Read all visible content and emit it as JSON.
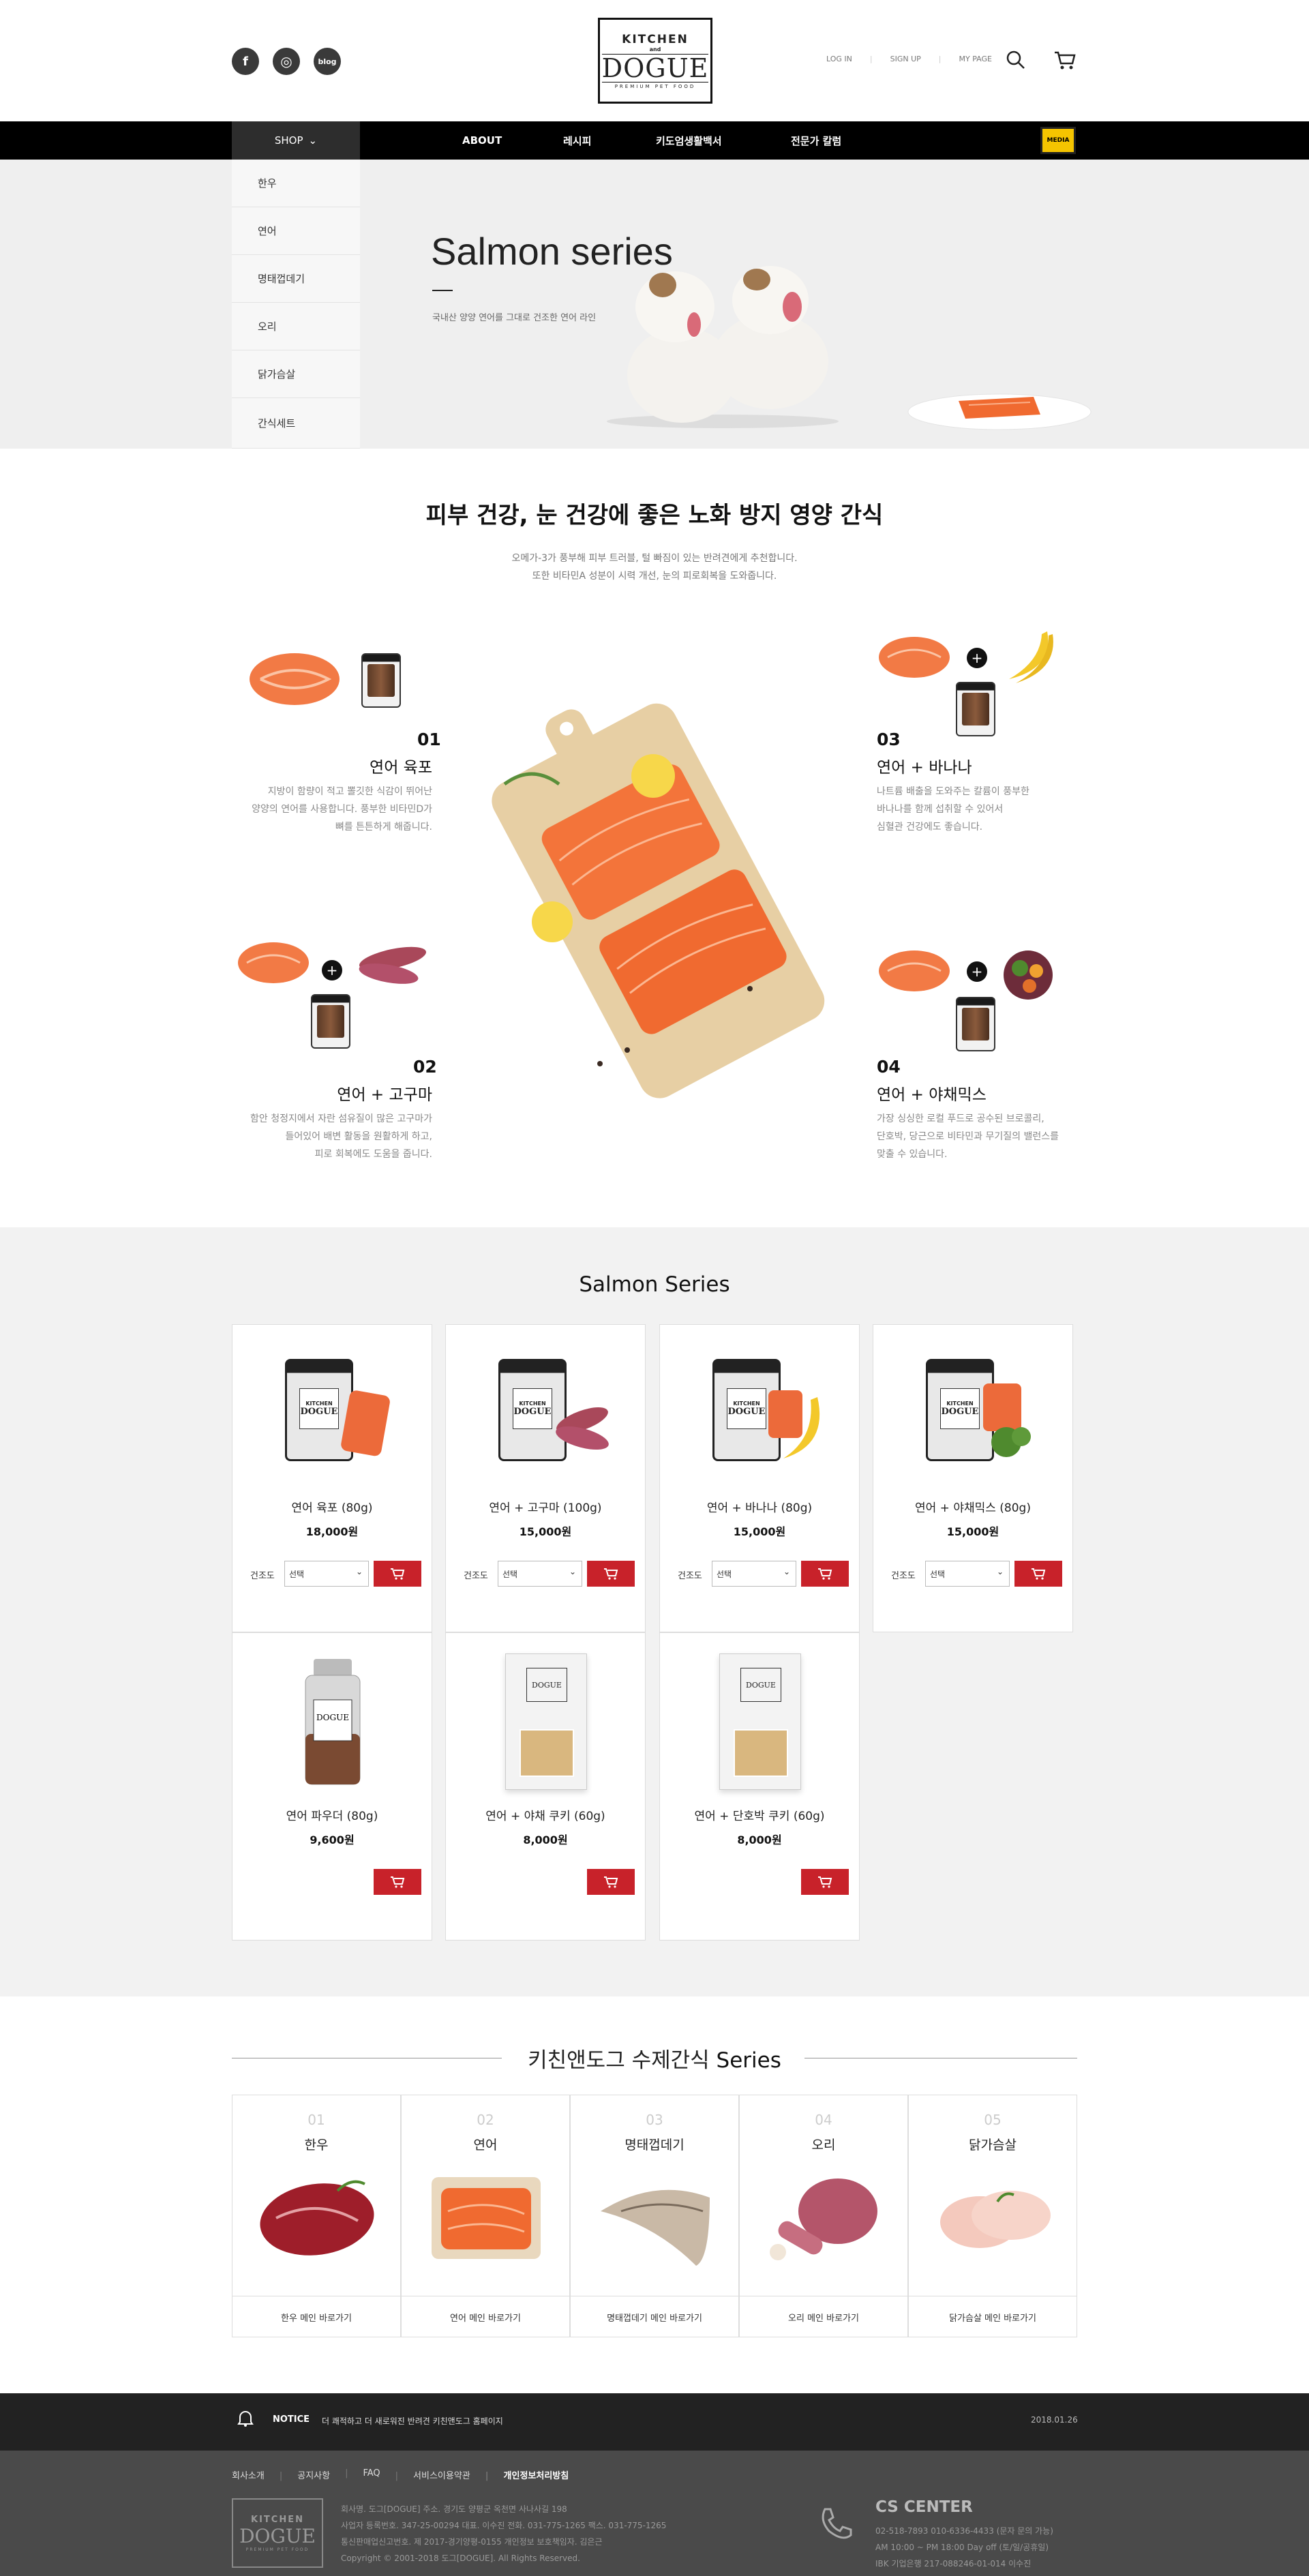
{
  "header": {
    "social": [
      {
        "icon": "facebook-icon",
        "glyph": "f"
      },
      {
        "icon": "instagram-icon",
        "glyph": "◎"
      },
      {
        "icon": "naver-blog-icon",
        "glyph": "blog"
      }
    ],
    "logo": {
      "kitchen": "KITCHEN",
      "and": "and",
      "dogue": "DOGUE",
      "tag": "PREMIUM PET FOOD"
    },
    "links": [
      "LOG IN",
      "SIGN UP",
      "MY PAGE"
    ]
  },
  "nav": {
    "shop": "SHOP",
    "items": [
      "ABOUT",
      "레시피",
      "키도엄생활백서",
      "전문가 칼럼"
    ],
    "media": "MEDIA"
  },
  "submenu": [
    "한우",
    "연어",
    "명태껍데기",
    "오리",
    "닭가슴살",
    "간식세트"
  ],
  "hero": {
    "title": "Salmon series",
    "desc": "국내산 양양 연어를 그대로 건조한 연어 라인"
  },
  "intro": {
    "title": "피부 건강, 눈 건강에 좋은 노화 방지 영양 간식",
    "desc1": "오메가-3가 풍부해 피부 트러블, 털 빠짐이 있는 반려견에게 추천합니다.",
    "desc2": "또한 비타민A 성분이 시력 개선, 눈의 피로회복을 도와줍니다."
  },
  "features": [
    {
      "num": "01",
      "title": "연어 육포",
      "d1": "지방이 함량이 적고 뽈깃한 식감이 뛰어난",
      "d2": "양양의 연어를 사용합니다. 풍부한 비타민D가",
      "d3": "뼈를 튼튼하게 해줍니다."
    },
    {
      "num": "02",
      "title": "연어 + 고구마",
      "d1": "함안 청정지에서 자란 섬유질이 많은 고구마가",
      "d2": "들어있어 배변 활동을 원활하게 하고,",
      "d3": "피로 회복에도 도움을 줍니다."
    },
    {
      "num": "03",
      "title": "연어 + 바나나",
      "d1": "나트륨 배출을 도와주는 칼륨이 풍부한",
      "d2": "바나나를 함께 섭취할 수 있어서",
      "d3": "심혈관 건강에도 좋습니다."
    },
    {
      "num": "04",
      "title": "연어 + 야채믹스",
      "d1": "가장 싱싱한 로컬 푸드로 공수된 브로콜리,",
      "d2": "단호박, 당근으로 비타민과 무기질의 밸런스를",
      "d3": "맞출 수 있습니다."
    }
  ],
  "products": {
    "title": "Salmon Series",
    "option_label": "건조도",
    "option_value": "선택",
    "items": [
      {
        "name": "연어 육포 (80g)",
        "price": "18,000원"
      },
      {
        "name": "연어 + 고구마 (100g)",
        "price": "15,000원"
      },
      {
        "name": "연어 + 바나나 (80g)",
        "price": "15,000원"
      },
      {
        "name": "연어 + 야채믹스 (80g)",
        "price": "15,000원"
      },
      {
        "name": "연어 파우더 (80g)",
        "price": "9,600원"
      },
      {
        "name": "연어 + 야채 쿠키 (60g)",
        "price": "8,000원"
      },
      {
        "name": "연어 + 단호박 쿠키 (60g)",
        "price": "8,000원"
      }
    ]
  },
  "series": {
    "title_kr": "키친앤도그 수제간식",
    "title_en": "Series",
    "items": [
      {
        "num": "01",
        "name": "한우",
        "link": "한우 메인 바로가기"
      },
      {
        "num": "02",
        "name": "연어",
        "link": "연어 메인 바로가기"
      },
      {
        "num": "03",
        "name": "명태껍데기",
        "link": "명태껍데기 메인 바로가기"
      },
      {
        "num": "04",
        "name": "오리",
        "link": "오리 메인 바로가기"
      },
      {
        "num": "05",
        "name": "닭가슴살",
        "link": "닭가슴살 메인 바로가기"
      }
    ]
  },
  "notice": {
    "label": "NOTICE",
    "text": "더 쾌적하고 더 새로워진 반려견 키친앤도그 홈페이지",
    "date": "2018.01.26"
  },
  "footer": {
    "links": [
      "회사소개",
      "공지사항",
      "FAQ",
      "서비스이용약관",
      "개인정보처리방침"
    ],
    "info1": "회사명. 도그[DOGUE]   주소. 경기도 양평군 옥천면 사나사길 198",
    "info2": "사업자 등록번호. 347-25-00294   대표. 이수진   전화. 031-775-1265   팩스. 031-775-1265",
    "info3": "통신판매업신고번호. 제 2017-경기양평-0155   개인정보 보호책임자. 김은근",
    "copy": "Copyright © 2001-2018 도그[DOGUE]. All Rights Reserved.",
    "cs_title": "CS CENTER",
    "cs1": "02-518-7893   010-6336-4433 (문자 문의 가능)",
    "cs2": "AM 10:00 ~ PM 18:00 Day off (토/일/공휴일)",
    "cs3": "IBK 기업은행 217-088246-01-014 이수진"
  },
  "colors": {
    "accent": "#c8222a",
    "nav": "#000000",
    "media": "#f5c400"
  }
}
